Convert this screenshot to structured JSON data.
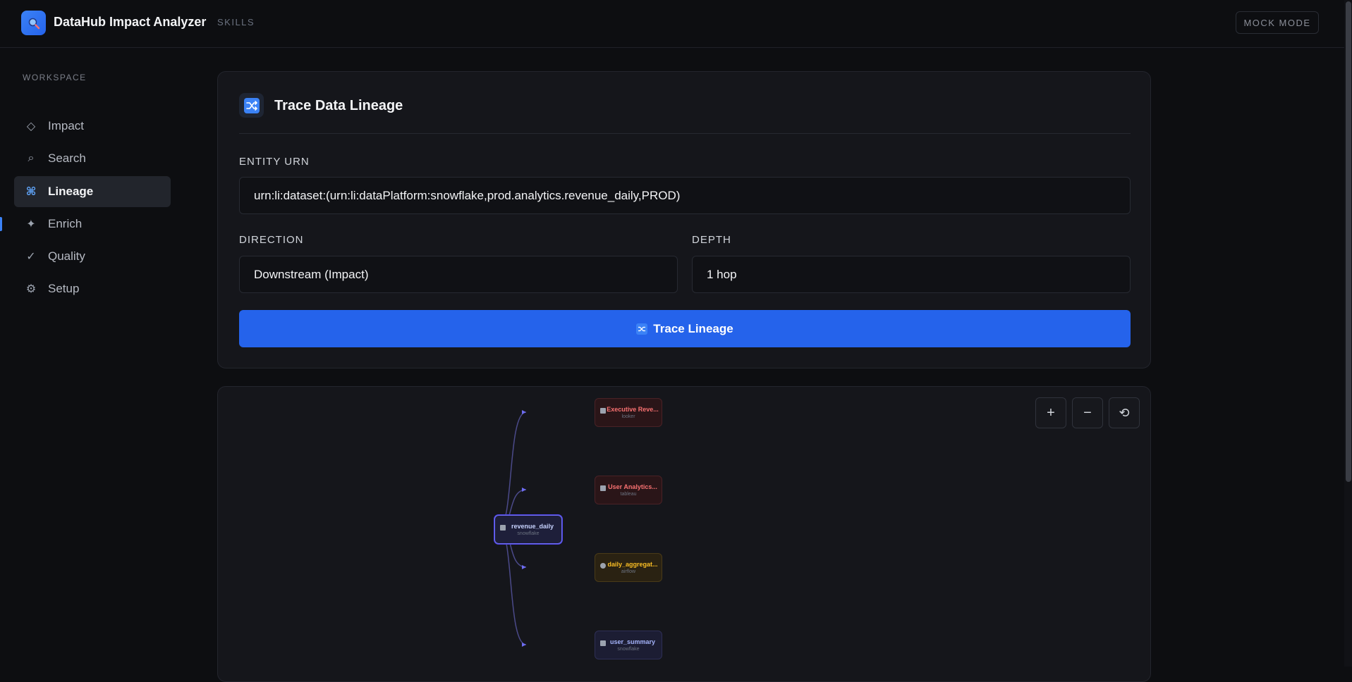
{
  "app": {
    "title": "DataHub Impact Analyzer",
    "subtitle": "SKILLS",
    "mode_label": "MOCK MODE"
  },
  "sidebar": {
    "section_label": "WORKSPACE",
    "items": [
      {
        "label": "Impact",
        "icon": "diamond-icon",
        "glyph": "◇"
      },
      {
        "label": "Search",
        "icon": "search-icon",
        "glyph": "⌕"
      },
      {
        "label": "Lineage",
        "icon": "command-icon",
        "glyph": "⌘",
        "active": true
      },
      {
        "label": "Enrich",
        "icon": "sparkle-icon",
        "glyph": "✦"
      },
      {
        "label": "Quality",
        "icon": "check-icon",
        "glyph": "✓"
      },
      {
        "label": "Setup",
        "icon": "gear-icon",
        "glyph": "⚙"
      }
    ]
  },
  "form": {
    "title": "Trace Data Lineage",
    "urn_label": "ENTITY URN",
    "urn_value": "urn:li:dataset:(urn:li:dataPlatform:snowflake,prod.analytics.revenue_daily,PROD)",
    "direction_label": "DIRECTION",
    "direction_value": "Downstream (Impact)",
    "depth_label": "DEPTH",
    "depth_value": "1 hop",
    "submit_label": "Trace Lineage"
  },
  "graph": {
    "controls": {
      "zoom_in": "+",
      "zoom_out": "−",
      "reset": "⟲"
    },
    "root": {
      "name": "revenue_daily",
      "platform": "snowflake"
    },
    "children": [
      {
        "name": "Executive Reve...",
        "platform": "looker",
        "kind": "dashboard"
      },
      {
        "name": "User Analytics...",
        "platform": "tableau",
        "kind": "dashboard"
      },
      {
        "name": "daily_aggregat...",
        "platform": "airflow",
        "kind": "job"
      },
      {
        "name": "user_summary",
        "platform": "snowflake",
        "kind": "dataset"
      }
    ]
  },
  "colors": {
    "accent": "#2563eb",
    "background": "#0d0e11",
    "card": "#15161b"
  }
}
